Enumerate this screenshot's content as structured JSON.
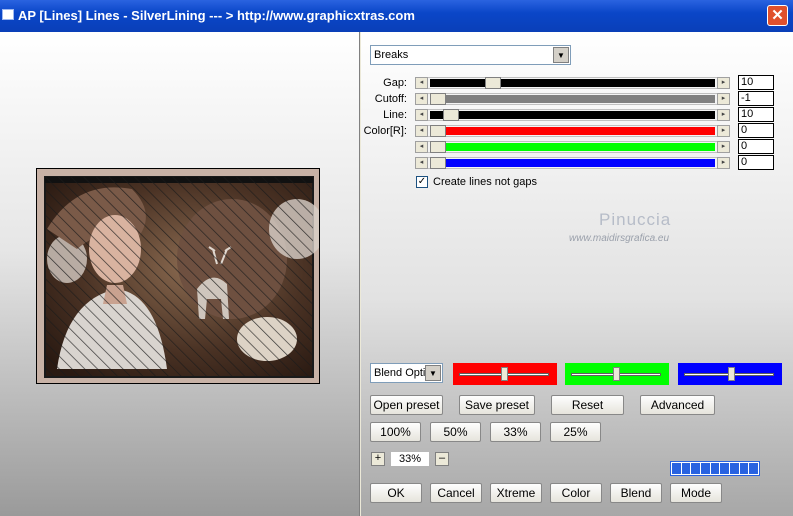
{
  "window": {
    "title": "AP [Lines]  Lines - SilverLining     --- > http://www.graphicxtras.com",
    "close_glyph": "✕"
  },
  "preview": {
    "description_icon": "photo-preview"
  },
  "controls": {
    "effect_dropdown": {
      "value": "Breaks"
    },
    "gap": {
      "label": "Gap:",
      "value": "10",
      "level": 0.27,
      "track_color": "#000000"
    },
    "cutoff": {
      "label": "Cutoff:",
      "value": "-1",
      "level": 0.0,
      "track_color": "#808080"
    },
    "line": {
      "label": "Line:",
      "value": "10",
      "level": 0.05,
      "track_color": "#000000"
    },
    "color_r": {
      "label": "Color[R]:",
      "value": "0",
      "level": 0.0,
      "track_color": "#ff0000"
    },
    "color_g": {
      "label": "",
      "value": "0",
      "level": 0.0,
      "track_color": "#00ff00"
    },
    "color_b": {
      "label": "",
      "value": "0",
      "level": 0.0,
      "track_color": "#0000ff"
    },
    "create_lines_checkbox": {
      "label": "Create lines not gaps",
      "checked": true,
      "check_glyph": "✓"
    },
    "arrow_left": "◂",
    "arrow_right": "▸",
    "dropdown_arrow": "▼"
  },
  "watermark": {
    "name": "Pinuccia",
    "url": "www.maidirsgrafica.eu"
  },
  "blend": {
    "dropdown_value": "Blend Options",
    "red_level": 0.55,
    "green_level": 0.5,
    "blue_level": 0.55
  },
  "buttons": {
    "open_preset": "Open preset",
    "save_preset": "Save preset",
    "reset": "Reset",
    "advanced": "Advanced",
    "zoom_100": "100%",
    "zoom_50": "50%",
    "zoom_33": "33%",
    "zoom_25": "25%",
    "ok": "OK",
    "cancel": "Cancel",
    "xtreme": "Xtreme",
    "color": "Color",
    "blend": "Blend",
    "mode": "Mode"
  },
  "zoom": {
    "plus": "+",
    "minus": "–",
    "value": "33%"
  },
  "progress": {
    "segments_filled": 9,
    "segments_total": 9
  },
  "colors": {
    "accent": "#2a63e0",
    "red": "#ff0000",
    "green": "#00ff00",
    "blue": "#0000ff"
  }
}
